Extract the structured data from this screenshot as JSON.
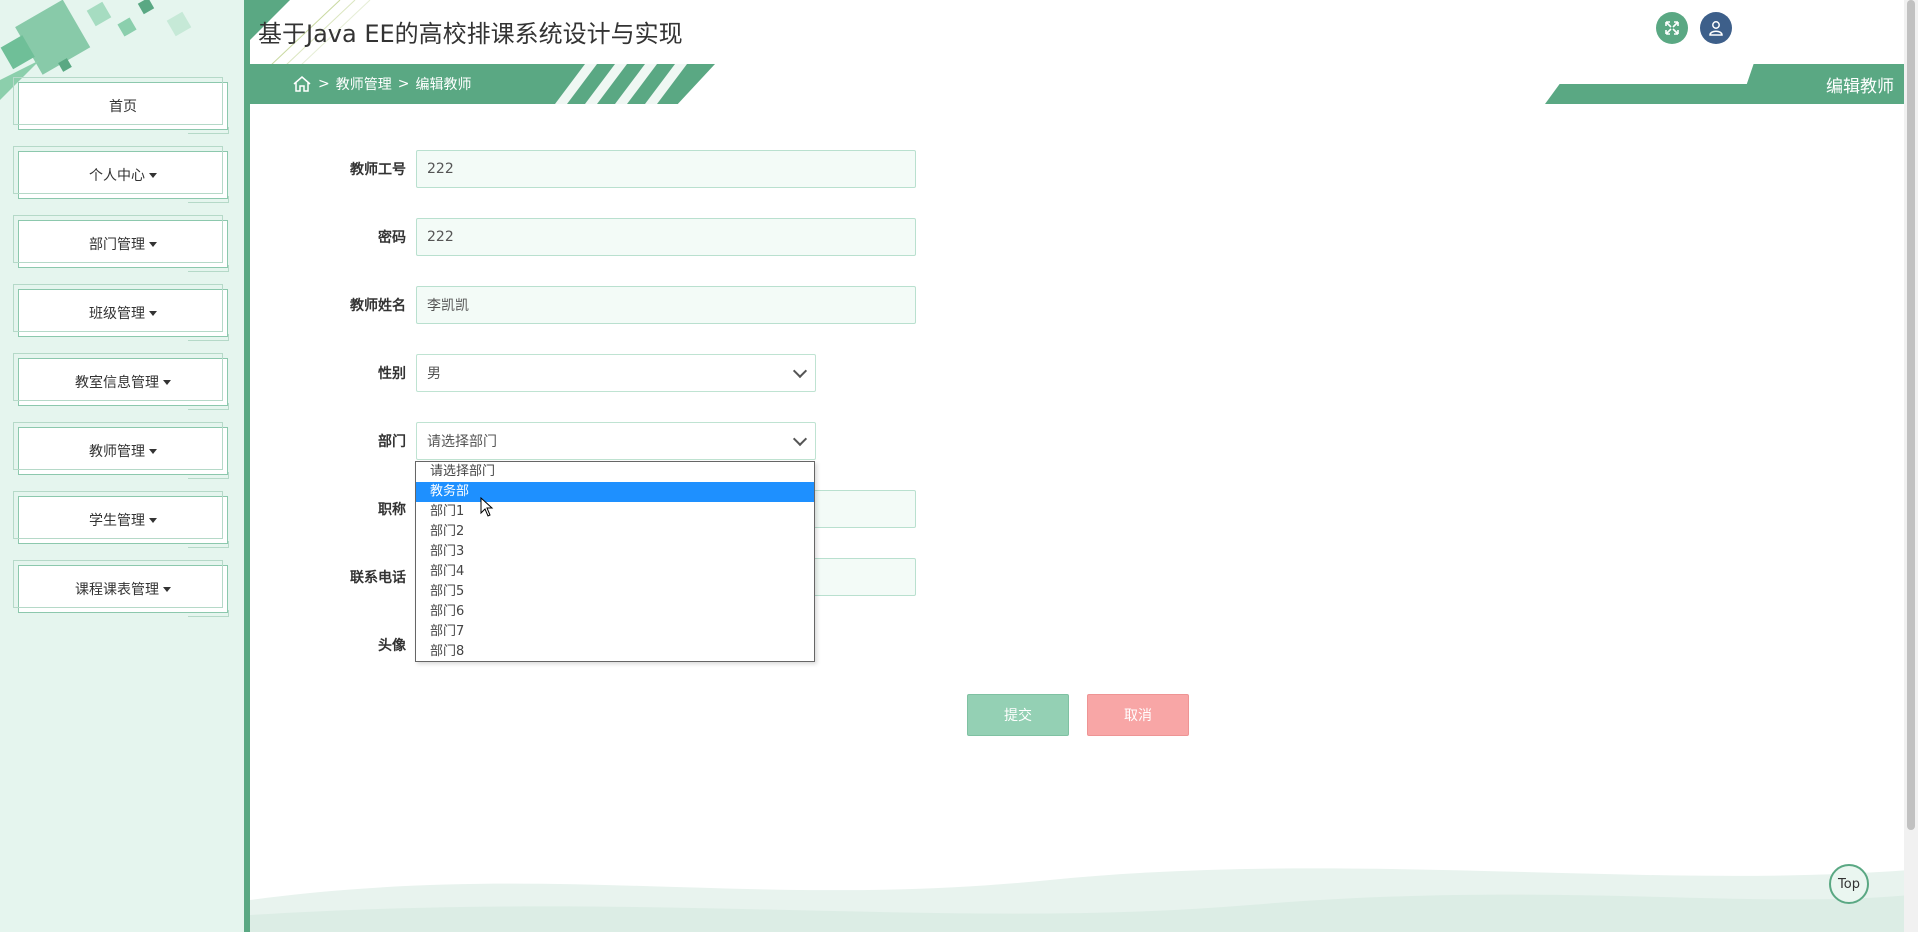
{
  "app": {
    "title": "基于Java EE的高校排课系统设计与实现"
  },
  "sidebar": {
    "items": [
      {
        "label": "首页",
        "has_caret": false
      },
      {
        "label": "个人中心",
        "has_caret": true
      },
      {
        "label": "部门管理",
        "has_caret": true
      },
      {
        "label": "班级管理",
        "has_caret": true
      },
      {
        "label": "教室信息管理",
        "has_caret": true
      },
      {
        "label": "教师管理",
        "has_caret": true
      },
      {
        "label": "学生管理",
        "has_caret": true
      },
      {
        "label": "课程课表管理",
        "has_caret": true
      }
    ]
  },
  "header": {
    "icons": [
      "fullscreen-icon",
      "user-icon"
    ]
  },
  "breadcrumb": {
    "home_icon": "home-icon",
    "separator": ">",
    "items": [
      "教师管理",
      "编辑教师"
    ]
  },
  "page_tag": "编辑教师",
  "form": {
    "teacher_id": {
      "label": "教师工号",
      "value": "222"
    },
    "password": {
      "label": "密码",
      "value": "222"
    },
    "name": {
      "label": "教师姓名",
      "value": "李凯凯"
    },
    "gender": {
      "label": "性别",
      "value": "男"
    },
    "department": {
      "label": "部门",
      "value": "请选择部门"
    },
    "title": {
      "label": "职称",
      "value": ""
    },
    "phone": {
      "label": "联系电话",
      "value": ""
    },
    "avatar": {
      "label": "头像"
    }
  },
  "department_dropdown": {
    "options": [
      "请选择部门",
      "教务部",
      "部门1",
      "部门2",
      "部门3",
      "部门4",
      "部门5",
      "部门6",
      "部门7",
      "部门8"
    ],
    "highlighted_index": 1
  },
  "buttons": {
    "submit": "提交",
    "cancel": "取消"
  },
  "back_to_top": "Top",
  "colors": {
    "primary": "#5aa883",
    "sidebar_bg": "#e5f5ee",
    "submit": "#94d0b4",
    "cancel": "#f8a6a6",
    "highlight": "#1e90ff"
  }
}
